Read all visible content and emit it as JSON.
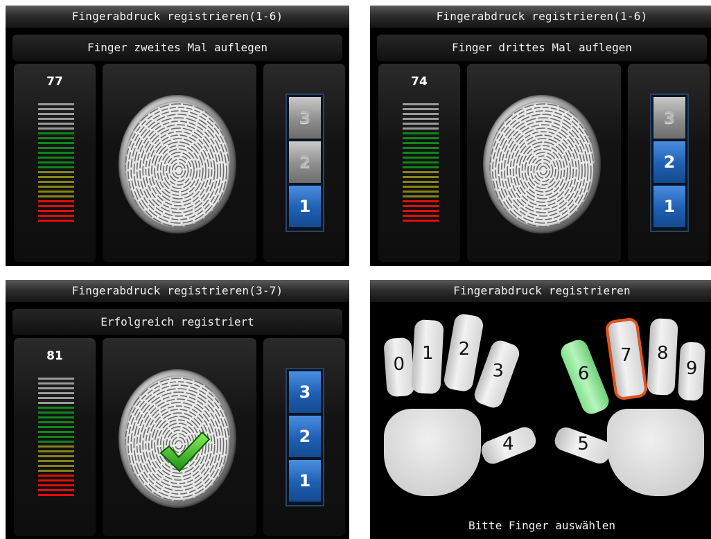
{
  "panels": [
    {
      "title": "Fingerabdruck registrieren(1-6)",
      "message": "Finger zweites Mal auflegen",
      "quality": "77",
      "steps": [
        {
          "label": "3",
          "state": "off"
        },
        {
          "label": "2",
          "state": "off"
        },
        {
          "label": "1",
          "state": "on"
        }
      ],
      "success": false
    },
    {
      "title": "Fingerabdruck registrieren(1-6)",
      "message": "Finger drittes Mal auflegen",
      "quality": "74",
      "steps": [
        {
          "label": "3",
          "state": "off"
        },
        {
          "label": "2",
          "state": "on"
        },
        {
          "label": "1",
          "state": "on"
        }
      ],
      "success": false
    },
    {
      "title": "Fingerabdruck registrieren(3-7)",
      "message": "Erfolgreich registriert",
      "quality": "81",
      "steps": [
        {
          "label": "3",
          "state": "on"
        },
        {
          "label": "2",
          "state": "on"
        },
        {
          "label": "1",
          "state": "on"
        }
      ],
      "success": true
    }
  ],
  "hand_screen": {
    "title": "Fingerabdruck registrieren",
    "prompt": "Bitte Finger auswählen",
    "fingers": [
      {
        "label": "0",
        "state": "normal"
      },
      {
        "label": "1",
        "state": "normal"
      },
      {
        "label": "2",
        "state": "normal"
      },
      {
        "label": "3",
        "state": "normal"
      },
      {
        "label": "4",
        "state": "normal"
      },
      {
        "label": "5",
        "state": "normal"
      },
      {
        "label": "6",
        "state": "enrolled"
      },
      {
        "label": "7",
        "state": "selected"
      },
      {
        "label": "8",
        "state": "normal"
      },
      {
        "label": "9",
        "state": "normal"
      }
    ]
  },
  "colors": {
    "bar_gray": "#9a9a9a",
    "bar_green": "#11861b",
    "bar_olive": "#868318",
    "bar_red": "#e00d0d",
    "finger_enrolled": "#7fe08a",
    "finger_selected_outline": "#e0531f"
  },
  "icons": [
    "fingerprint-icon",
    "checkmark-icon"
  ]
}
